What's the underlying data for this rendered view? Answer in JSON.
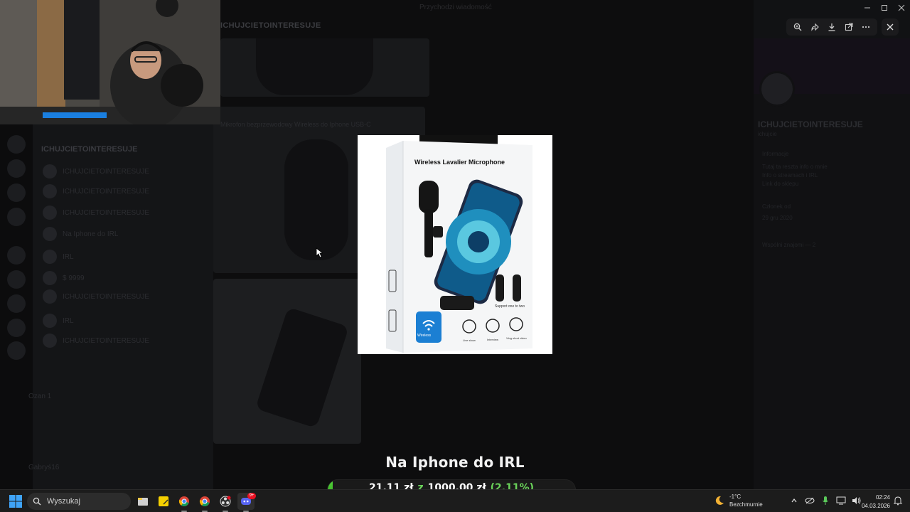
{
  "window": {
    "title": "Przychodzi wiadomość",
    "server_title": "ICHUJCIETOINTERESUJE"
  },
  "channels": {
    "header": "ICHUJCIETOINTERESUJE",
    "items": [
      {
        "label": "ICHUJCIETOINTERESUJE"
      },
      {
        "label": "ICHUJCIETOINTERESUJE"
      },
      {
        "label": "ICHUJCIETOINTERESUJE"
      },
      {
        "label": "Na Iphone do IRL"
      },
      {
        "label": "IRL"
      },
      {
        "label": "$ 9999"
      },
      {
        "label": "ICHUJCIETOINTERESUJE"
      },
      {
        "label": "IRL"
      },
      {
        "label": "ICHUJCIETOINTERESUJE"
      }
    ],
    "voice_label": "Ozan 1",
    "user_label": "Gabryś16"
  },
  "message": {
    "caption": "Mikrofon bezprzewodowy Wireless do Iphone USB-C"
  },
  "profile": {
    "name": "ICHUJCIETOINTERESUJE",
    "handle": "ichujcie",
    "section_about": "Informacje",
    "about_lines": [
      "Tutaj ta reszta info o mnie",
      "Info o streamach i IRL",
      "Link do sklepu"
    ],
    "member_since_label": "Członek od",
    "member_since": "29 gru 2020",
    "mutual": "Wspólni znajomi — 2"
  },
  "lightbox": {
    "toolbar": [
      {
        "name": "zoom-in-icon"
      },
      {
        "name": "forward-icon"
      },
      {
        "name": "download-icon"
      },
      {
        "name": "open-external-icon"
      },
      {
        "name": "more-icon"
      }
    ]
  },
  "product_box": {
    "brand_text": "Wireless Lavalier Microphone",
    "wireless_badge": "Wireless",
    "icon_labels": [
      "Live show",
      "Interview",
      "Vlog short video"
    ],
    "support_text": "Support one to two"
  },
  "goal": {
    "title": "Na Iphone do IRL",
    "current": "21,11 zł",
    "of_word": "z",
    "target": "1000,00 zł",
    "percent_text": "(2.11%)",
    "progress_fraction": 0.0211
  },
  "taskbar": {
    "search_placeholder": "Wyszukaj",
    "apps": [
      "file-explorer-icon",
      "sticky-notes-icon",
      "chrome-icon",
      "chrome-profile-icon",
      "obs-icon",
      "discord-icon"
    ],
    "discord_badge": "9+",
    "weather_temp": "-1°C",
    "weather_desc": "Bezchmurnie",
    "time": "02:24",
    "date": "04.03.2026"
  },
  "colors": {
    "accent_green": "#6ad25a",
    "taskbar_bg": "#1c1c1c",
    "discord_blurple": "#5865f2"
  }
}
